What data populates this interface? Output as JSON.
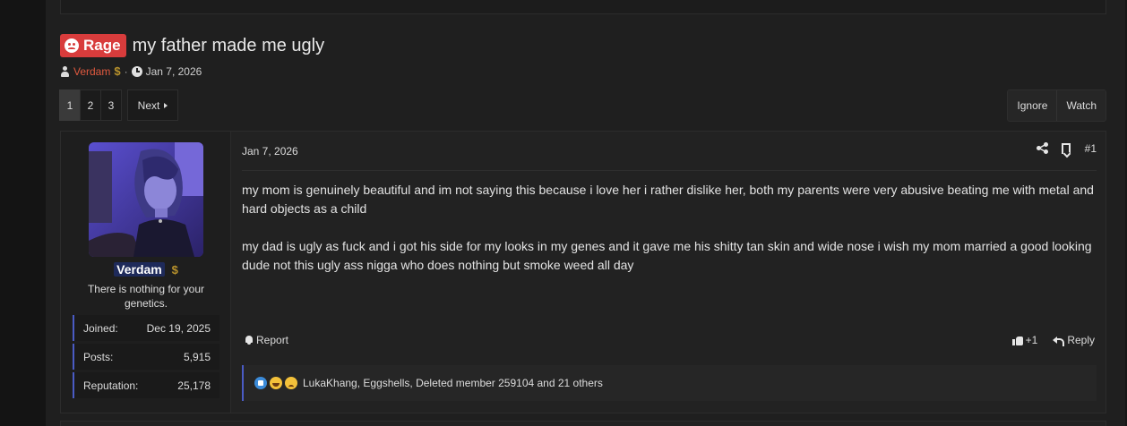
{
  "thread": {
    "prefix": "Rage",
    "title": "my father made me ugly",
    "author": "Verdam",
    "date": "Jan 7, 2026",
    "separator": "·"
  },
  "pagination": {
    "pages": [
      "1",
      "2",
      "3"
    ],
    "current": "1",
    "next_label": "Next"
  },
  "thread_actions": {
    "ignore": "Ignore",
    "watch": "Watch"
  },
  "post": {
    "date": "Jan 7, 2026",
    "number": "#1",
    "paragraphs": [
      "my mom is genuinely beautiful and im not saying this because i love her i rather dislike her, both my parents were very abusive beating me with metal and hard objects as a child",
      "my dad is ugly as fuck and i got his side for my looks in my genes and it gave me his shitty tan skin and wide nose i wish my mom married a good looking dude not this ugly ass nigga who does nothing but smoke weed all day"
    ],
    "report_label": "Report",
    "react_label": "+1",
    "reply_label": "Reply",
    "reactions_text": "LukaKhang, Eggshells, Deleted member 259104 and 21 others",
    "reaction_icons": [
      "like-icon",
      "laugh-icon",
      "sad-icon"
    ]
  },
  "user": {
    "name": "Verdam",
    "badge": "$",
    "title": "There is nothing for your genetics.",
    "stats": [
      {
        "label": "Joined:",
        "value": "Dec 19, 2025"
      },
      {
        "label": "Posts:",
        "value": "5,915"
      },
      {
        "label": "Reputation:",
        "value": "25,178"
      }
    ]
  },
  "colors": {
    "prefix_bg": "#d83c3c",
    "username": "#e0593f",
    "accent": "#4a5bc4",
    "badge": "#b8922c"
  }
}
